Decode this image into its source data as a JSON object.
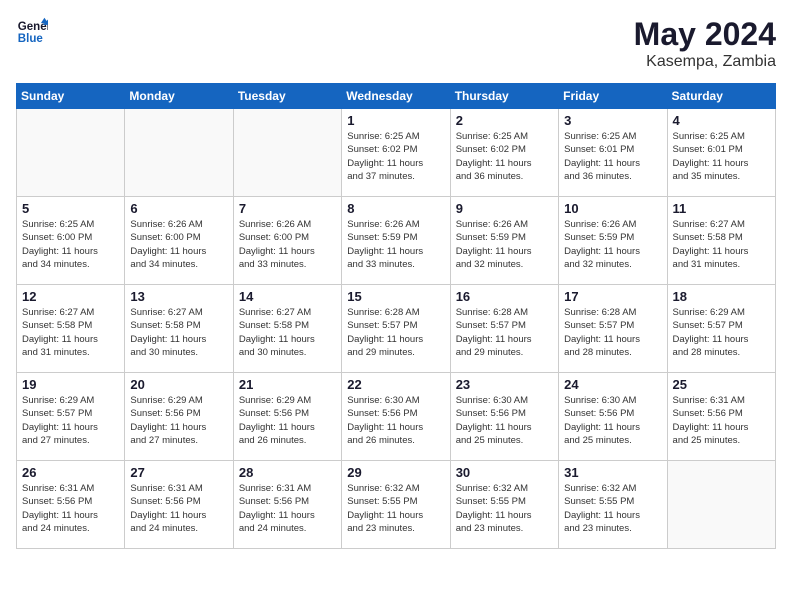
{
  "header": {
    "logo_line1": "General",
    "logo_line2": "Blue",
    "title": "May 2024",
    "subtitle": "Kasempa, Zambia"
  },
  "weekdays": [
    "Sunday",
    "Monday",
    "Tuesday",
    "Wednesday",
    "Thursday",
    "Friday",
    "Saturday"
  ],
  "weeks": [
    [
      {
        "day": "",
        "info": ""
      },
      {
        "day": "",
        "info": ""
      },
      {
        "day": "",
        "info": ""
      },
      {
        "day": "1",
        "info": "Sunrise: 6:25 AM\nSunset: 6:02 PM\nDaylight: 11 hours\nand 37 minutes."
      },
      {
        "day": "2",
        "info": "Sunrise: 6:25 AM\nSunset: 6:02 PM\nDaylight: 11 hours\nand 36 minutes."
      },
      {
        "day": "3",
        "info": "Sunrise: 6:25 AM\nSunset: 6:01 PM\nDaylight: 11 hours\nand 36 minutes."
      },
      {
        "day": "4",
        "info": "Sunrise: 6:25 AM\nSunset: 6:01 PM\nDaylight: 11 hours\nand 35 minutes."
      }
    ],
    [
      {
        "day": "5",
        "info": "Sunrise: 6:25 AM\nSunset: 6:00 PM\nDaylight: 11 hours\nand 34 minutes."
      },
      {
        "day": "6",
        "info": "Sunrise: 6:26 AM\nSunset: 6:00 PM\nDaylight: 11 hours\nand 34 minutes."
      },
      {
        "day": "7",
        "info": "Sunrise: 6:26 AM\nSunset: 6:00 PM\nDaylight: 11 hours\nand 33 minutes."
      },
      {
        "day": "8",
        "info": "Sunrise: 6:26 AM\nSunset: 5:59 PM\nDaylight: 11 hours\nand 33 minutes."
      },
      {
        "day": "9",
        "info": "Sunrise: 6:26 AM\nSunset: 5:59 PM\nDaylight: 11 hours\nand 32 minutes."
      },
      {
        "day": "10",
        "info": "Sunrise: 6:26 AM\nSunset: 5:59 PM\nDaylight: 11 hours\nand 32 minutes."
      },
      {
        "day": "11",
        "info": "Sunrise: 6:27 AM\nSunset: 5:58 PM\nDaylight: 11 hours\nand 31 minutes."
      }
    ],
    [
      {
        "day": "12",
        "info": "Sunrise: 6:27 AM\nSunset: 5:58 PM\nDaylight: 11 hours\nand 31 minutes."
      },
      {
        "day": "13",
        "info": "Sunrise: 6:27 AM\nSunset: 5:58 PM\nDaylight: 11 hours\nand 30 minutes."
      },
      {
        "day": "14",
        "info": "Sunrise: 6:27 AM\nSunset: 5:58 PM\nDaylight: 11 hours\nand 30 minutes."
      },
      {
        "day": "15",
        "info": "Sunrise: 6:28 AM\nSunset: 5:57 PM\nDaylight: 11 hours\nand 29 minutes."
      },
      {
        "day": "16",
        "info": "Sunrise: 6:28 AM\nSunset: 5:57 PM\nDaylight: 11 hours\nand 29 minutes."
      },
      {
        "day": "17",
        "info": "Sunrise: 6:28 AM\nSunset: 5:57 PM\nDaylight: 11 hours\nand 28 minutes."
      },
      {
        "day": "18",
        "info": "Sunrise: 6:29 AM\nSunset: 5:57 PM\nDaylight: 11 hours\nand 28 minutes."
      }
    ],
    [
      {
        "day": "19",
        "info": "Sunrise: 6:29 AM\nSunset: 5:57 PM\nDaylight: 11 hours\nand 27 minutes."
      },
      {
        "day": "20",
        "info": "Sunrise: 6:29 AM\nSunset: 5:56 PM\nDaylight: 11 hours\nand 27 minutes."
      },
      {
        "day": "21",
        "info": "Sunrise: 6:29 AM\nSunset: 5:56 PM\nDaylight: 11 hours\nand 26 minutes."
      },
      {
        "day": "22",
        "info": "Sunrise: 6:30 AM\nSunset: 5:56 PM\nDaylight: 11 hours\nand 26 minutes."
      },
      {
        "day": "23",
        "info": "Sunrise: 6:30 AM\nSunset: 5:56 PM\nDaylight: 11 hours\nand 25 minutes."
      },
      {
        "day": "24",
        "info": "Sunrise: 6:30 AM\nSunset: 5:56 PM\nDaylight: 11 hours\nand 25 minutes."
      },
      {
        "day": "25",
        "info": "Sunrise: 6:31 AM\nSunset: 5:56 PM\nDaylight: 11 hours\nand 25 minutes."
      }
    ],
    [
      {
        "day": "26",
        "info": "Sunrise: 6:31 AM\nSunset: 5:56 PM\nDaylight: 11 hours\nand 24 minutes."
      },
      {
        "day": "27",
        "info": "Sunrise: 6:31 AM\nSunset: 5:56 PM\nDaylight: 11 hours\nand 24 minutes."
      },
      {
        "day": "28",
        "info": "Sunrise: 6:31 AM\nSunset: 5:56 PM\nDaylight: 11 hours\nand 24 minutes."
      },
      {
        "day": "29",
        "info": "Sunrise: 6:32 AM\nSunset: 5:55 PM\nDaylight: 11 hours\nand 23 minutes."
      },
      {
        "day": "30",
        "info": "Sunrise: 6:32 AM\nSunset: 5:55 PM\nDaylight: 11 hours\nand 23 minutes."
      },
      {
        "day": "31",
        "info": "Sunrise: 6:32 AM\nSunset: 5:55 PM\nDaylight: 11 hours\nand 23 minutes."
      },
      {
        "day": "",
        "info": ""
      }
    ]
  ]
}
